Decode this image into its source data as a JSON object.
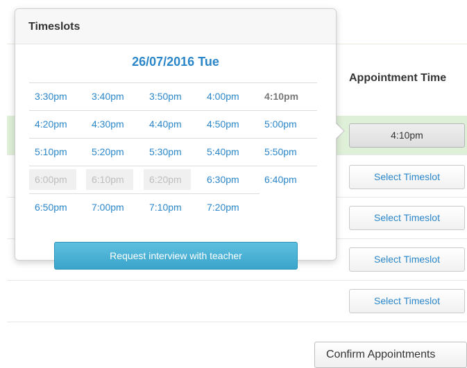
{
  "table": {
    "column_header": "Appointment Time",
    "row_buttons": [
      "4:10pm",
      "Select Timeslot",
      "Select Timeslot",
      "Select Timeslot",
      "Select Timeslot"
    ],
    "confirm_label": "Confirm Appointments",
    "highlight_color": "#dff0d8"
  },
  "popover": {
    "title": "Timeslots",
    "date": "26/07/2016 Tue",
    "request_label": "Request interview with teacher",
    "selected_slot": "4:10pm",
    "slot_rows": [
      [
        {
          "t": "3:30pm",
          "s": "open"
        },
        {
          "t": "3:40pm",
          "s": "open"
        },
        {
          "t": "3:50pm",
          "s": "open"
        },
        {
          "t": "4:00pm",
          "s": "open"
        },
        {
          "t": "4:10pm",
          "s": "selected"
        }
      ],
      [
        {
          "t": "4:20pm",
          "s": "open"
        },
        {
          "t": "4:30pm",
          "s": "open"
        },
        {
          "t": "4:40pm",
          "s": "open"
        },
        {
          "t": "4:50pm",
          "s": "open"
        },
        {
          "t": "5:00pm",
          "s": "open"
        }
      ],
      [
        {
          "t": "5:10pm",
          "s": "open"
        },
        {
          "t": "5:20pm",
          "s": "open"
        },
        {
          "t": "5:30pm",
          "s": "open"
        },
        {
          "t": "5:40pm",
          "s": "open"
        },
        {
          "t": "5:50pm",
          "s": "open"
        }
      ],
      [
        {
          "t": "6:00pm",
          "s": "taken"
        },
        {
          "t": "6:10pm",
          "s": "taken"
        },
        {
          "t": "6:20pm",
          "s": "taken"
        },
        {
          "t": "6:30pm",
          "s": "open"
        },
        {
          "t": "6:40pm",
          "s": "open"
        }
      ],
      [
        {
          "t": "6:50pm",
          "s": "open"
        },
        {
          "t": "7:00pm",
          "s": "open"
        },
        {
          "t": "7:10pm",
          "s": "open"
        },
        {
          "t": "7:20pm",
          "s": "open"
        }
      ]
    ],
    "accent_color": "#2a86c9"
  }
}
